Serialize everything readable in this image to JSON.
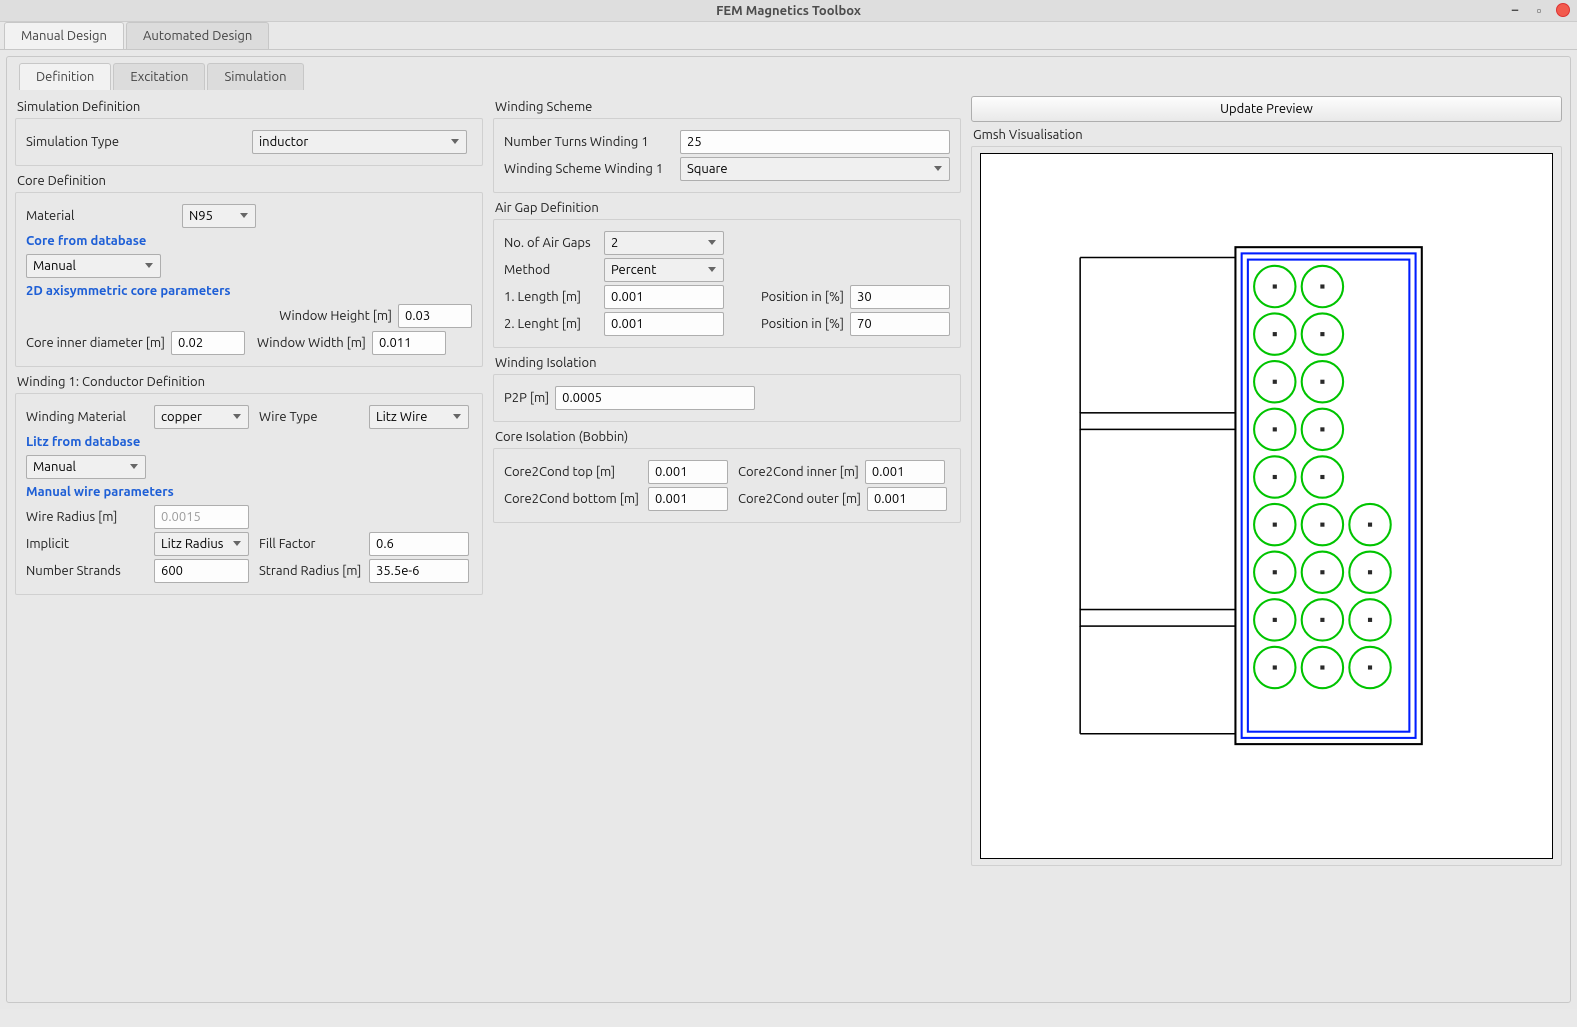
{
  "window": {
    "title": "FEM Magnetics Toolbox"
  },
  "outer_tabs": {
    "manual": "Manual Design",
    "automated": "Automated Design"
  },
  "inner_tabs": {
    "definition": "Definition",
    "excitation": "Excitation",
    "simulation": "Simulation"
  },
  "sim_def": {
    "heading": "Simulation Definition",
    "type_label": "Simulation Type",
    "type_value": "inductor"
  },
  "core_def": {
    "heading": "Core Definition",
    "material_label": "Material",
    "material_value": "N95",
    "link1": "Core from database",
    "db_value": "Manual",
    "link2": "2D axisymmetric core parameters",
    "win_h_label": "Window Height [m]",
    "win_h_value": "0.03",
    "inner_d_label": "Core inner diameter [m]",
    "inner_d_value": "0.02",
    "win_w_label": "Window Width [m]",
    "win_w_value": "0.011"
  },
  "winding_def": {
    "heading": "Winding 1: Conductor Definition",
    "material_label": "Winding Material",
    "material_value": "copper",
    "wiretype_label": "Wire Type",
    "wiretype_value": "Litz Wire",
    "link1": "Litz from database",
    "litz_db_value": "Manual",
    "link2": "Manual wire parameters",
    "radius_label": "Wire Radius [m]",
    "radius_value": "0.0015",
    "implicit_label": "Implicit",
    "implicit_value": "Litz Radius",
    "fill_label": "Fill Factor",
    "fill_value": "0.6",
    "strands_label": "Number Strands",
    "strands_value": "600",
    "strand_r_label": "Strand Radius [m]",
    "strand_r_value": "35.5e-6"
  },
  "winding_scheme": {
    "heading": "Winding Scheme",
    "turns_label": "Number Turns Winding 1",
    "turns_value": "25",
    "scheme_label": "Winding Scheme Winding 1",
    "scheme_value": "Square"
  },
  "airgap": {
    "heading": "Air Gap Definition",
    "n_label": "No. of Air Gaps",
    "n_value": "2",
    "method_label": "Method",
    "method_value": "Percent",
    "l1_label": "1. Length [m]",
    "l1_value": "0.001",
    "p1_label": "Position in [%]",
    "p1_value": "30",
    "l2_label": "2. Lenght [m]",
    "l2_value": "0.001",
    "p2_label": "Position in [%]",
    "p2_value": "70"
  },
  "winding_iso": {
    "heading": "Winding Isolation",
    "p2p_label": "P2P [m]",
    "p2p_value": "0.0005"
  },
  "core_iso": {
    "heading": "Core Isolation (Bobbin)",
    "top_label": "Core2Cond top [m]",
    "top_value": "0.001",
    "inner_label": "Core2Cond inner [m]",
    "inner_value": "0.001",
    "bottom_label": "Core2Cond bottom [m]",
    "bottom_value": "0.001",
    "outer_label": "Core2Cond outer [m]",
    "outer_value": "0.001"
  },
  "preview": {
    "button": "Update Preview",
    "heading": "Gmsh Visualisation"
  }
}
